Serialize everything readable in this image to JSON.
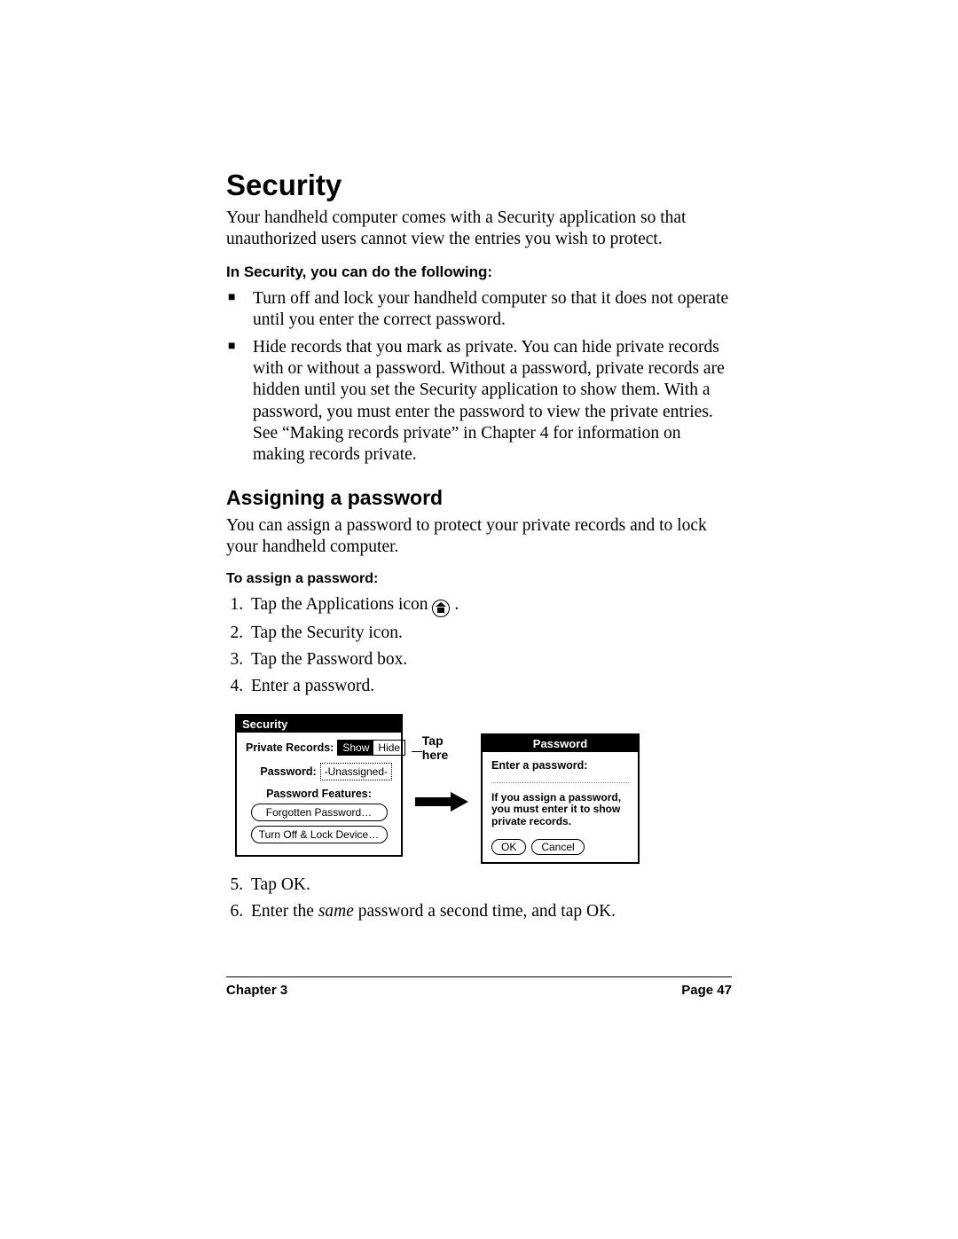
{
  "heading": "Security",
  "intro": "Your handheld computer comes with a Security application so that unauthorized users cannot view the entries you wish to protect.",
  "can_do_label": "In Security, you can do the following:",
  "bullets": [
    "Turn off and lock your handheld computer so that it does not operate until you enter the correct password.",
    "Hide records that you mark as private. You can hide private records with or without a password. Without a password, private records are hidden until you set the Security application to show them. With a password, you must enter the password to view the private entries. See “Making records private” in Chapter 4 for information on making records private."
  ],
  "assign_heading": "Assigning a password",
  "assign_intro": "You can assign a password to protect your private records and to lock your handheld computer.",
  "steps_label": "To assign a password:",
  "steps_part1": [
    "Tap the Applications icon",
    "Tap the Security icon.",
    "Tap the Password box.",
    "Enter a password."
  ],
  "steps_part2": [
    "Tap OK.",
    "Enter the same password a second time, and tap OK."
  ],
  "step6_prefix": "Enter the ",
  "step6_italic": "same",
  "step6_suffix": " password a second time, and tap OK.",
  "figure": {
    "security_title": "Security",
    "private_records_label": "Private Records:",
    "seg_show": "Show",
    "seg_hide": "Hide",
    "password_label": "Password:",
    "password_value": "-Unassigned-",
    "features_label": "Password Features:",
    "forgotten_btn": "Forgotten Password…",
    "turnoff_btn": "Turn Off & Lock Device…",
    "tap_here": "Tap here",
    "pw_title": "Password",
    "pw_prompt": "Enter a password:",
    "pw_info": "If you assign a password, you must enter it to show private records.",
    "ok_btn": "OK",
    "cancel_btn": "Cancel"
  },
  "footer": {
    "chapter": "Chapter 3",
    "page": "Page 47"
  }
}
